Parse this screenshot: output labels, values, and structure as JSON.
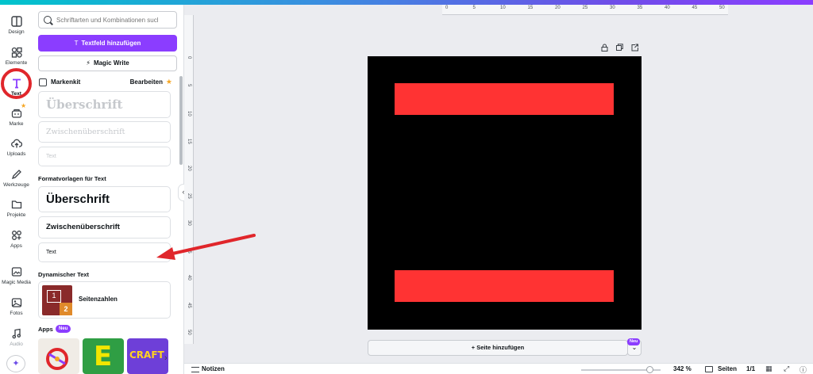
{
  "colors": {
    "accent": "#8b3dff",
    "active_marker": "#e0262b",
    "canvas_bg": "#000000",
    "shape_fill": "#ff3333",
    "arrow": "#e0262b"
  },
  "rail": {
    "items": [
      {
        "label": "Design",
        "icon": "layout-icon"
      },
      {
        "label": "Elemente",
        "icon": "shapes-icon"
      },
      {
        "label": "Text",
        "icon": "text-t-icon"
      },
      {
        "label": "Marke",
        "icon": "brand-icon"
      },
      {
        "label": "Uploads",
        "icon": "cloud-upload-icon"
      },
      {
        "label": "Werkzeuge",
        "icon": "pen-icon"
      },
      {
        "label": "Projekte",
        "icon": "folder-icon"
      },
      {
        "label": "Apps",
        "icon": "apps-grid-icon"
      },
      {
        "label": "Magic Media",
        "icon": "magic-media-icon"
      },
      {
        "label": "Fotos",
        "icon": "photo-icon"
      },
      {
        "label": "Audio",
        "icon": "music-note-icon"
      }
    ]
  },
  "panel": {
    "search_placeholder": "Schriftarten und Kombinationen sucl",
    "add_textbox_label": "Textfeld hinzufügen",
    "magic_write_label": "Magic Write",
    "brand_kit": {
      "title": "Markenkit",
      "edit": "Bearbeiten"
    },
    "brand_styles": {
      "heading": "Überschrift",
      "subheading": "Zwischenüberschrift",
      "body": "Text"
    },
    "templates_title": "Formatvorlagen für Text",
    "templates": {
      "heading": "Überschrift",
      "subheading": "Zwischenüberschrift",
      "body": "Text"
    },
    "dynamic_title": "Dynamischer Text",
    "dynamic_item": {
      "label": "Seitenzahlen",
      "thumb_a": "1",
      "thumb_b": "2"
    },
    "apps_title": "Apps",
    "apps_badge": "Neu",
    "app_tiles": [
      "E",
      "CRAFT"
    ]
  },
  "canvas": {
    "ruler_top": [
      "0",
      "5",
      "10",
      "15",
      "20",
      "25",
      "30",
      "35",
      "40",
      "45",
      "50"
    ],
    "ruler_left": [
      "0",
      "5",
      "10",
      "15",
      "20",
      "25",
      "30",
      "35",
      "40",
      "45",
      "50"
    ],
    "add_page_label": "+ Seite hinzufügen",
    "add_page_badge": "Neu"
  },
  "bottombar": {
    "notes_label": "Notizen",
    "zoom": "342 %",
    "zoom_fraction": 0.86,
    "pages_label": "Seiten",
    "page_count": "1/1"
  }
}
